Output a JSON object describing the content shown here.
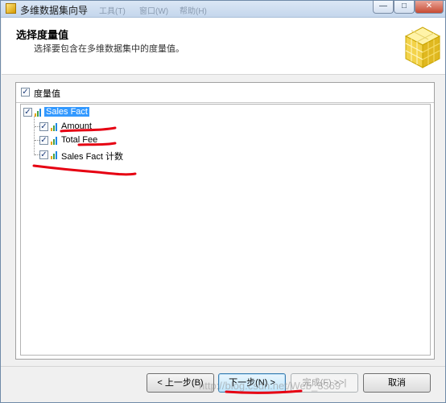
{
  "window": {
    "title": "多维数据集向导",
    "behind_title_fragments": [
      "工具(T)",
      "窗口(W)",
      "帮助(H)"
    ],
    "controls": {
      "minimize": "—",
      "maximize": "□",
      "close": "✕"
    }
  },
  "header": {
    "title": "选择度量值",
    "subtitle": "选择要包含在多维数据集中的度量值。",
    "icon": "cube-icon"
  },
  "panel": {
    "header_label": "度量值",
    "header_checked": true
  },
  "tree": {
    "root": {
      "label": "Sales Fact",
      "checked": true,
      "selected": true
    },
    "children": [
      {
        "label": "Amount",
        "checked": true
      },
      {
        "label": "Total Fee",
        "checked": true
      },
      {
        "label": "Sales Fact 计数",
        "checked": true
      }
    ]
  },
  "buttons": {
    "back": "< 上一步(B)",
    "next": "下一步(N) >",
    "finish": "完成(F) >>|",
    "cancel": "取消"
  },
  "watermark": "http://blog.csdn.net/Web_3369",
  "colors": {
    "selection": "#3399ff",
    "annotation_red": "#e60012",
    "measure_bars": [
      "#e8a400",
      "#43a047",
      "#1e88e5"
    ]
  }
}
